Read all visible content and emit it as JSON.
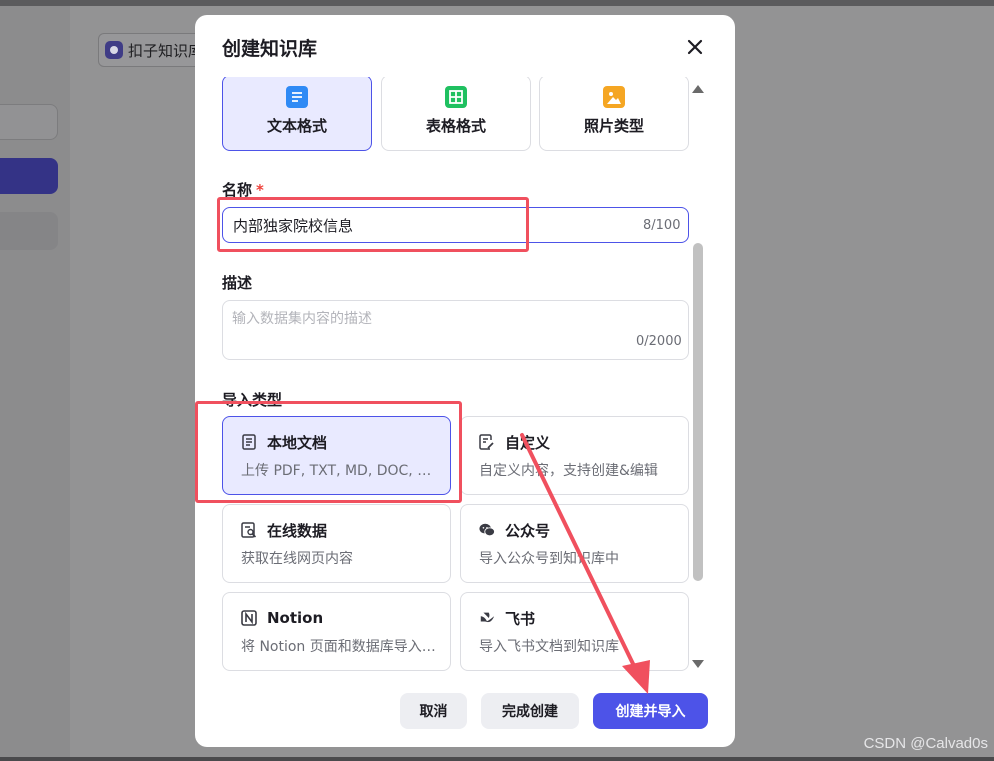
{
  "background": {
    "chip_label": "扣子知识库",
    "watermark": "CSDN @Calvad0s"
  },
  "modal": {
    "title": "创建知识库",
    "format_options": [
      {
        "label": "文本格式",
        "icon": "text-doc-icon",
        "color": "#2f8af5",
        "selected": true
      },
      {
        "label": "表格格式",
        "icon": "table-icon",
        "color": "#1fc060",
        "selected": false
      },
      {
        "label": "照片类型",
        "icon": "image-icon",
        "color": "#f5a623",
        "selected": false
      }
    ],
    "name": {
      "label": "名称",
      "required_mark": "*",
      "value": "内部独家院校信息",
      "counter": "8/100"
    },
    "description": {
      "label": "描述",
      "placeholder": "输入数据集内容的描述",
      "counter": "0/2000"
    },
    "import_type": {
      "label": "导入类型",
      "options": [
        {
          "title": "本地文档",
          "desc": "上传 PDF, TXT, MD, DOC, DOCX 格式的本地文件",
          "icon": "local-doc-icon",
          "selected": true
        },
        {
          "title": "自定义",
          "desc": "自定义内容，支持创建&编辑",
          "icon": "custom-edit-icon",
          "selected": false
        },
        {
          "title": "在线数据",
          "desc": "获取在线网页内容",
          "icon": "online-data-icon",
          "selected": false
        },
        {
          "title": "公众号",
          "desc": "导入公众号到知识库中",
          "icon": "wechat-icon",
          "selected": false
        },
        {
          "title": "Notion",
          "desc": "将 Notion 页面和数据库导入到知识库中",
          "icon": "notion-icon",
          "selected": false
        },
        {
          "title": "飞书",
          "desc": "导入飞书文档到知识库",
          "icon": "feishu-icon",
          "selected": false
        }
      ]
    },
    "buttons": {
      "cancel": "取消",
      "finish": "完成创建",
      "create_import": "创建并导入"
    }
  },
  "colors": {
    "accent": "#4d53e8",
    "annotation": "#f0505e"
  }
}
